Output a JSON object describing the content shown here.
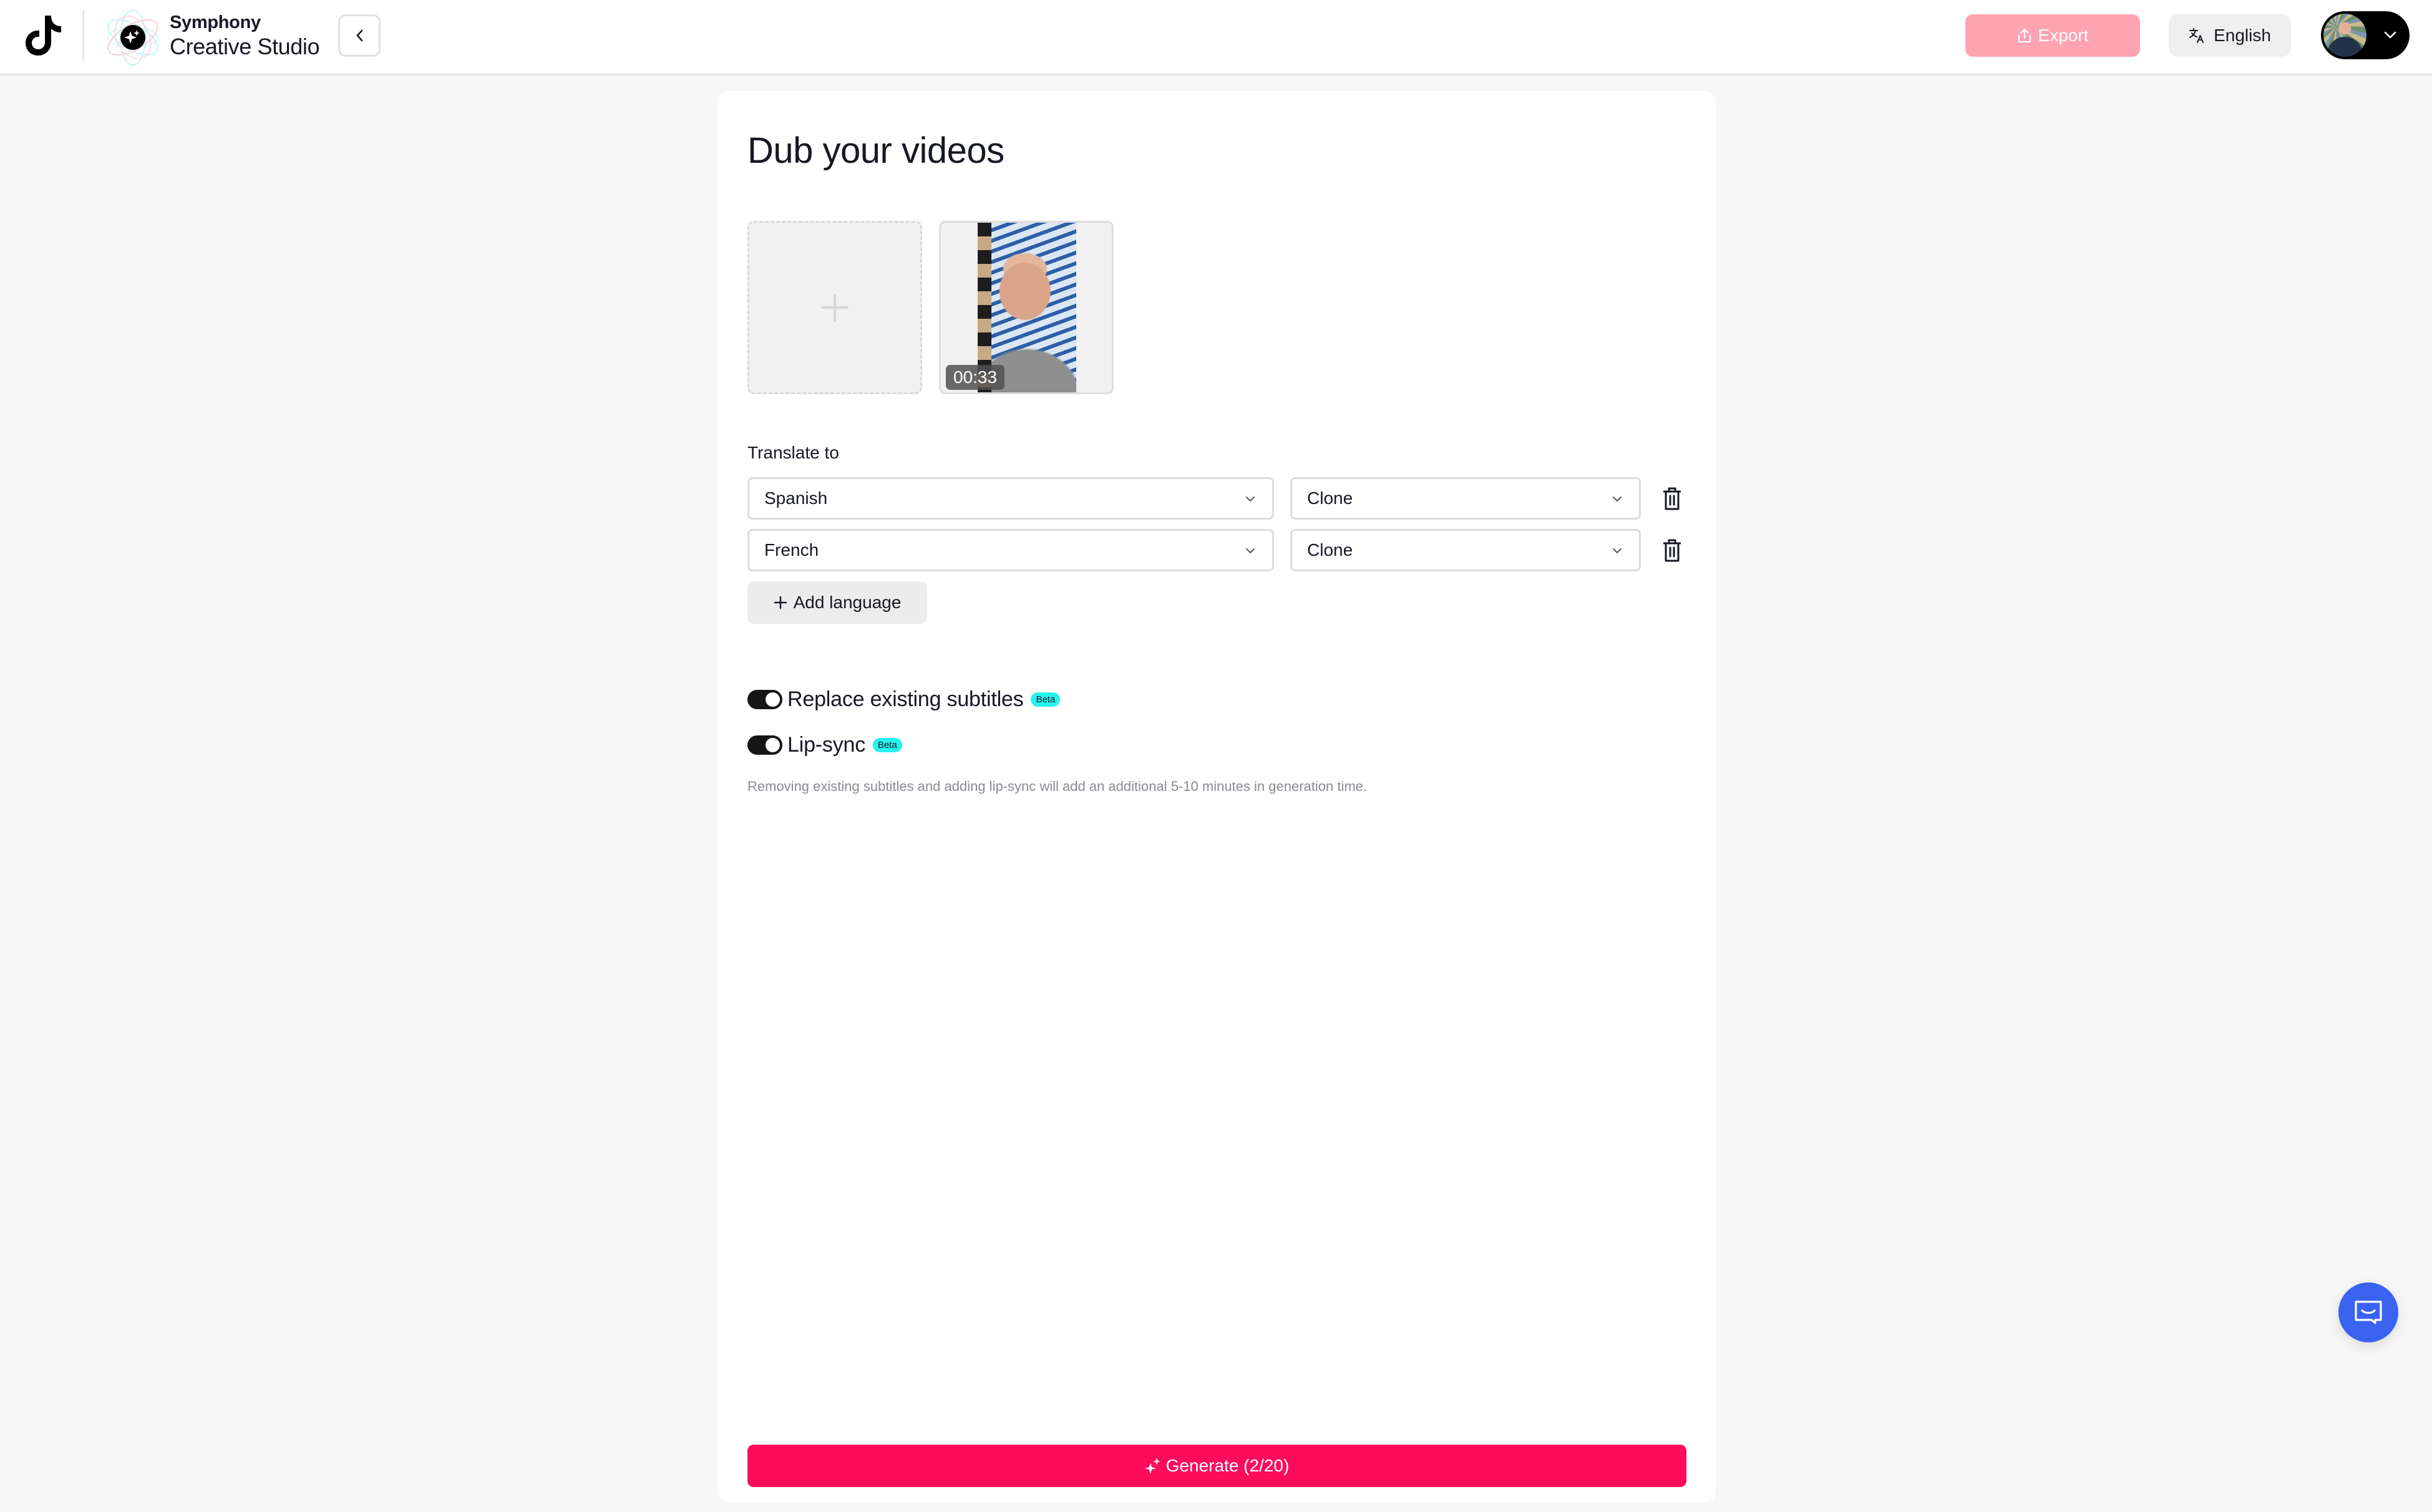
{
  "header": {
    "brand_name": "Symphony",
    "brand_product": "Creative Studio",
    "back_icon": "chevron-left-icon",
    "export_label": "Export",
    "export_icon": "upload-icon",
    "language_label": "English",
    "language_icon": "translate-icon",
    "account_icon": "chevron-down-icon"
  },
  "page": {
    "title": "Dub your videos"
  },
  "media": {
    "upload_icon": "plus-icon",
    "videos": [
      {
        "duration": "00:33"
      }
    ]
  },
  "translate": {
    "label": "Translate to",
    "rows": [
      {
        "language": "Spanish",
        "voice": "Clone"
      },
      {
        "language": "French",
        "voice": "Clone"
      }
    ],
    "add_label": "Add language"
  },
  "options": {
    "replace_subtitles": {
      "label": "Replace existing subtitles",
      "badge": "Beta",
      "enabled": true
    },
    "lip_sync": {
      "label": "Lip-sync",
      "badge": "Beta",
      "enabled": true
    },
    "note": "Removing existing subtitles and adding lip-sync will add an additional 5-10 minutes in generation time."
  },
  "generate": {
    "label": "Generate (2/20)",
    "used": 2,
    "limit": 20
  },
  "colors": {
    "accent": "#fe0b5b",
    "export_disabled": "#fea3b2",
    "beta": "#25f4ee",
    "chat": "#3a64ef"
  }
}
